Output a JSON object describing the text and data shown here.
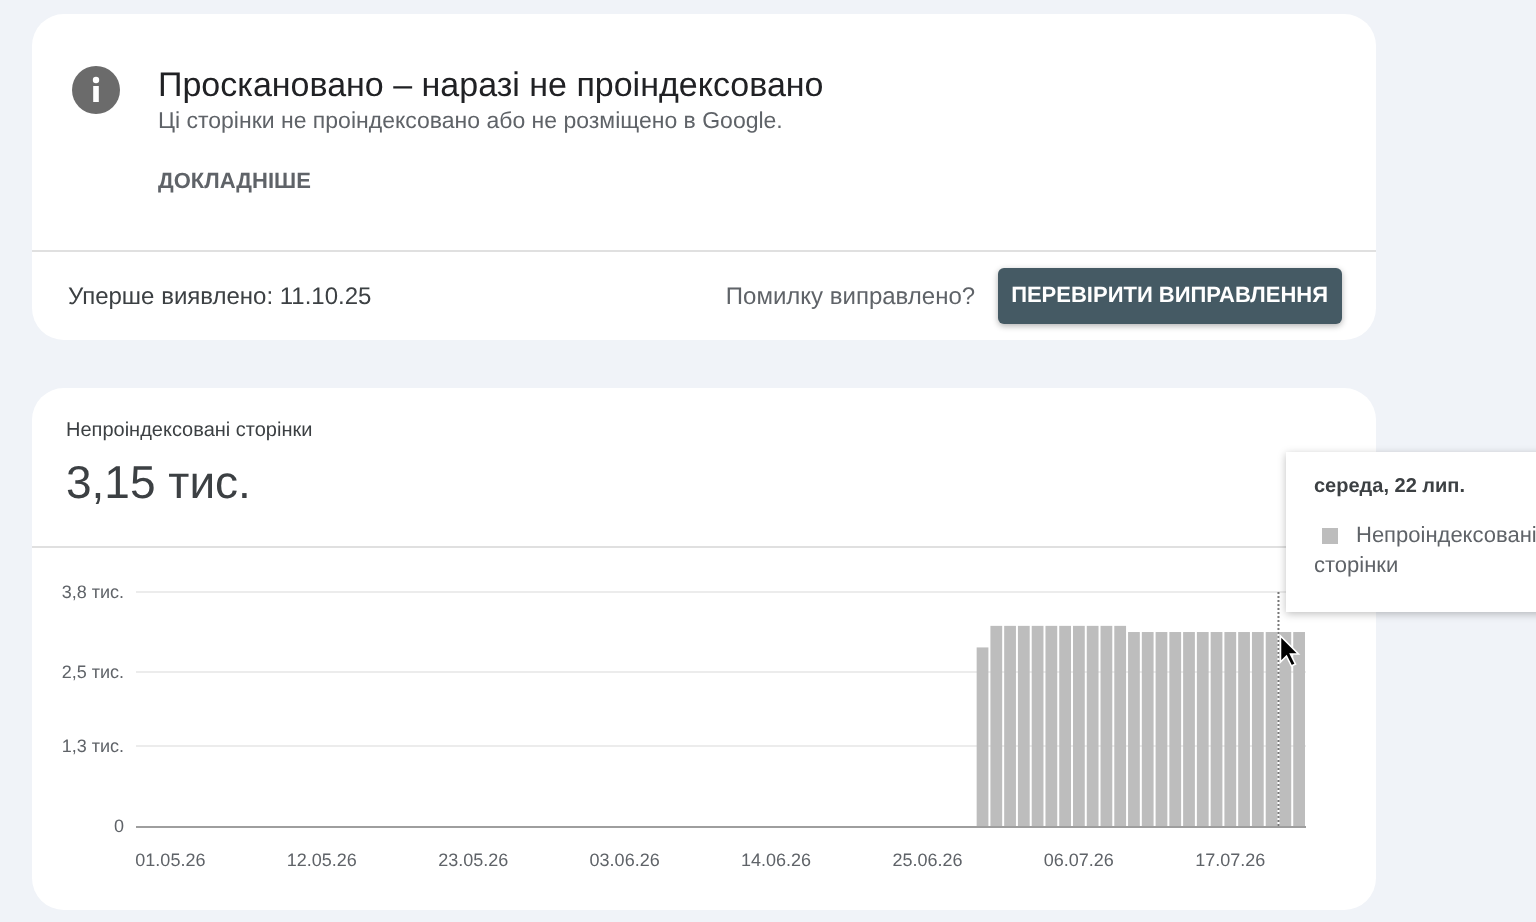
{
  "issue": {
    "title": "Проскановано – наразі не проіндексовано",
    "description": "Ці сторінки не проіндексовано або не розміщено в Google.",
    "learn_more": "ДОКЛАДНІШЕ",
    "first_detected": "Уперше виявлено: 11.10.25",
    "fixed_question": "Помилку виправлено?",
    "validate_button": "ПЕРЕВІРИТИ ВИПРАВЛЕННЯ"
  },
  "stats": {
    "label": "Непроіндексовані сторінки",
    "value": "3,15 тис.",
    "chart_data": {
      "type": "bar",
      "ylim": [
        0,
        3.8
      ],
      "yticks": [
        {
          "value": 0,
          "label": "0"
        },
        {
          "value": 1.3,
          "label": "1,3 тис."
        },
        {
          "value": 2.5,
          "label": "2,5 тис."
        },
        {
          "value": 3.8,
          "label": "3,8 тис."
        }
      ],
      "categories": [
        null,
        null,
        "01.05.26",
        null,
        null,
        null,
        null,
        null,
        null,
        null,
        null,
        null,
        null,
        "12.05.26",
        null,
        null,
        null,
        null,
        null,
        null,
        null,
        null,
        null,
        null,
        "23.05.26",
        null,
        null,
        null,
        null,
        null,
        null,
        null,
        null,
        null,
        null,
        "03.06.26",
        null,
        null,
        null,
        null,
        null,
        null,
        null,
        null,
        null,
        null,
        "14.06.26",
        null,
        null,
        null,
        null,
        null,
        null,
        null,
        null,
        null,
        null,
        "25.06.26",
        null,
        null,
        null,
        null,
        null,
        null,
        null,
        null,
        null,
        null,
        "06.07.26",
        null,
        null,
        null,
        null,
        null,
        null,
        null,
        null,
        null,
        null,
        "17.07.26",
        null,
        null,
        null,
        null,
        null
      ],
      "series": [
        {
          "color": "#bdbdbd",
          "values": [
            null,
            null,
            null,
            null,
            null,
            null,
            null,
            null,
            null,
            null,
            null,
            null,
            null,
            null,
            null,
            null,
            null,
            null,
            null,
            null,
            null,
            null,
            null,
            null,
            null,
            null,
            null,
            null,
            null,
            null,
            null,
            null,
            null,
            null,
            null,
            null,
            null,
            null,
            null,
            null,
            null,
            null,
            null,
            null,
            null,
            null,
            null,
            null,
            null,
            null,
            null,
            null,
            null,
            null,
            null,
            null,
            null,
            null,
            null,
            null,
            null,
            2.9,
            3.25,
            3.25,
            3.25,
            3.25,
            3.25,
            3.25,
            3.25,
            3.25,
            3.25,
            3.25,
            3.15,
            3.15,
            3.15,
            3.15,
            3.15,
            3.15,
            3.15,
            3.15,
            3.15,
            3.15,
            3.15,
            3.15,
            3.15
          ]
        }
      ]
    },
    "tooltip": {
      "date": "середа, 22 лип.",
      "series_label": "Непроіндексовані",
      "series_label_cont": "сторінки"
    }
  }
}
